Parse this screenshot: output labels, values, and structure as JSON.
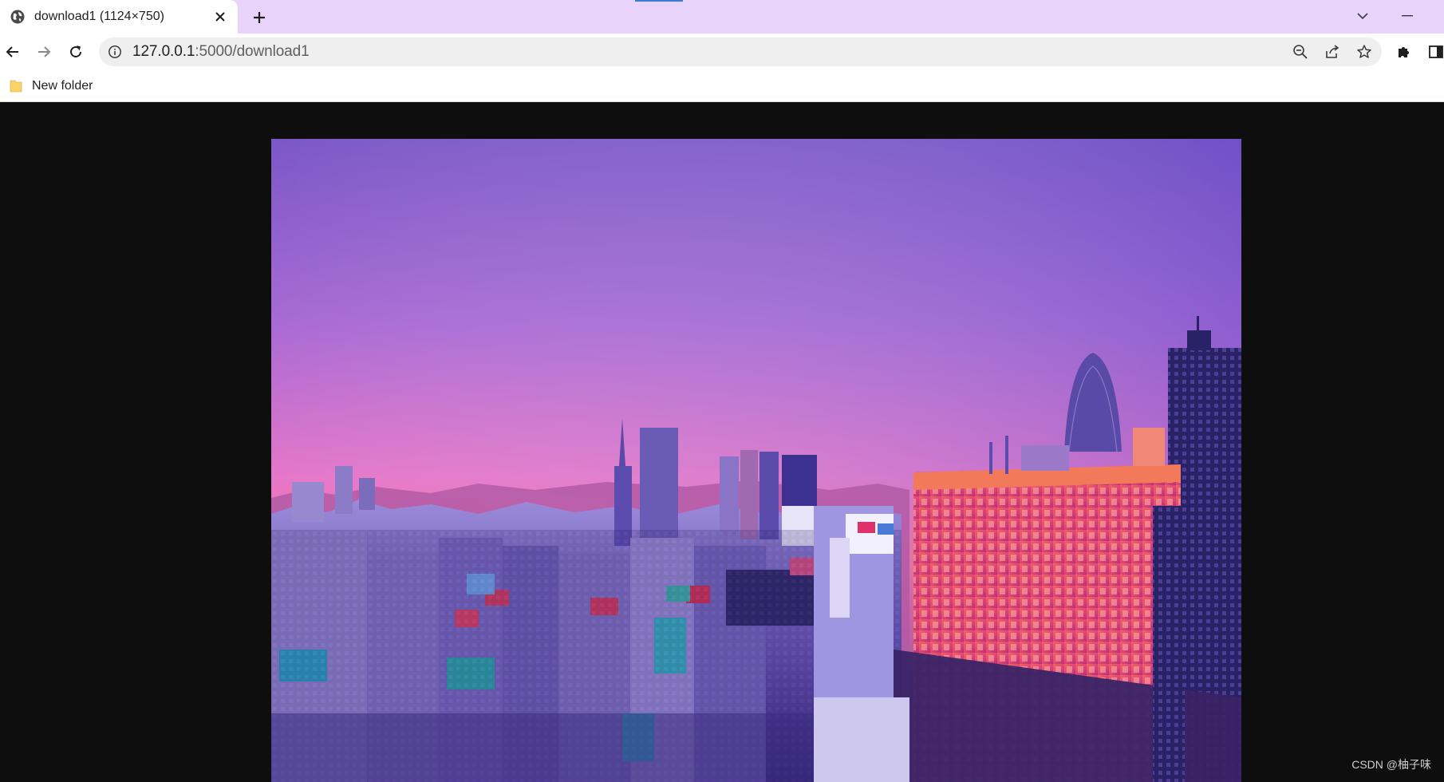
{
  "browser": {
    "tab": {
      "title": "download1 (1124×750)",
      "icon": "globe-icon"
    },
    "new_tab_icon": "plus-icon",
    "tab_list_icon": "chevron-down-icon",
    "minimize_icon": "minimize-icon",
    "nav": {
      "back_icon": "back-arrow-icon",
      "forward_icon": "forward-arrow-icon",
      "reload_icon": "reload-icon"
    },
    "omnibox": {
      "host": "127.0.0.1",
      "path": ":5000/download1",
      "icons": [
        "info-icon",
        "zoom-out-icon",
        "share-icon",
        "star-icon"
      ]
    },
    "toolbar_icons": [
      "puzzle-icon",
      "side-panel-icon"
    ],
    "bookmarks": [
      {
        "label": "New folder",
        "icon": "folder-icon"
      }
    ]
  },
  "content": {
    "image_natural_size": "1124×750",
    "image_subject": "city-skyline-at-dusk"
  },
  "watermark": "CSDN @柚子味",
  "colors": {
    "tab_strip": "#e8d4fb",
    "viewport_bg": "#0e0e0e",
    "sky_top": "#7a55c7",
    "sky_horizon": "#f06aa0"
  }
}
